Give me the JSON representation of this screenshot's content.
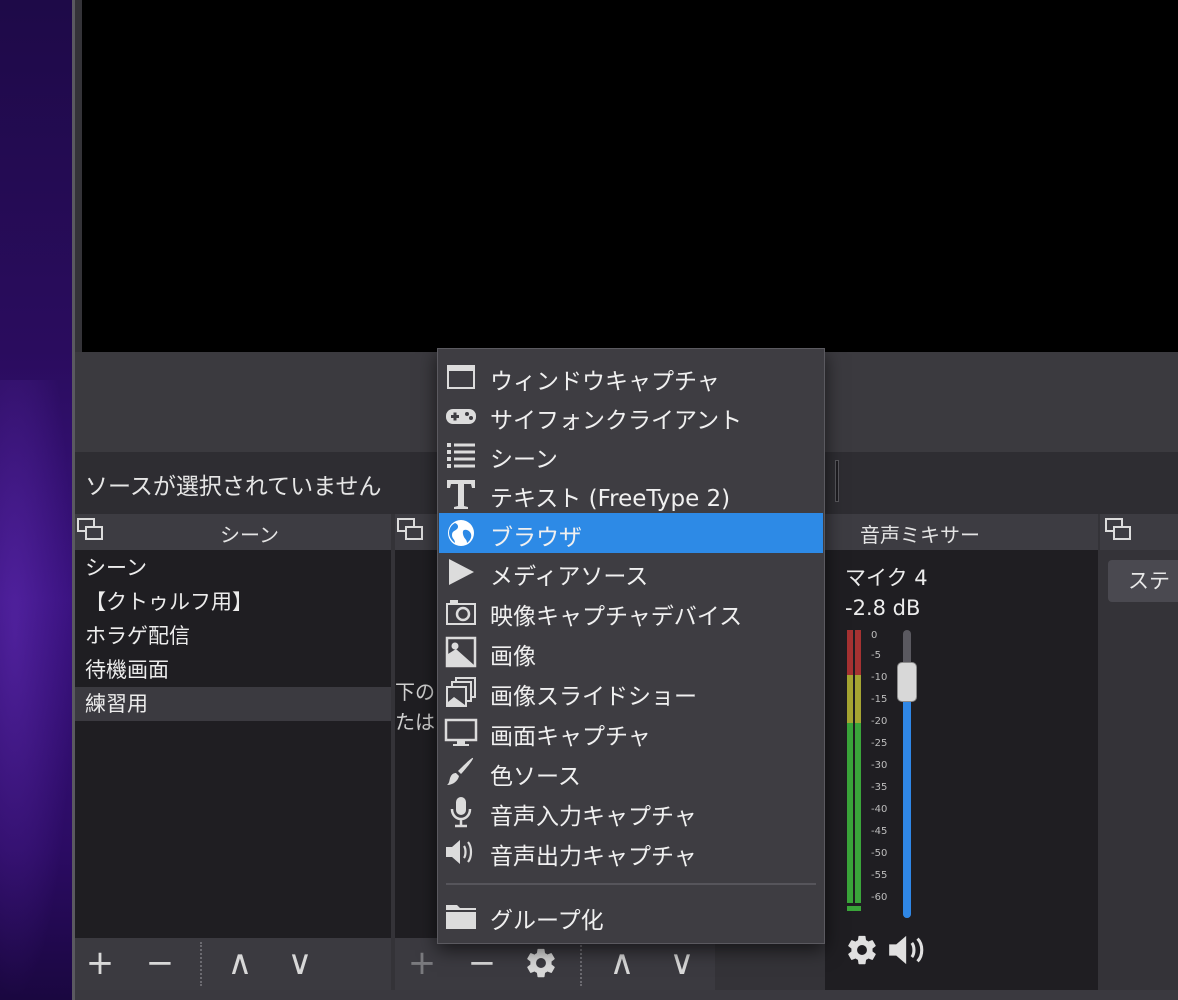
{
  "status": {
    "no_source_text": "ソースが選択されていません"
  },
  "scenes_dock": {
    "title": "シーン",
    "items": [
      {
        "label": "シーン",
        "selected": false
      },
      {
        "label": "【クトゥルフ用】",
        "selected": false
      },
      {
        "label": "ホラゲ配信",
        "selected": false
      },
      {
        "label": "待機画面",
        "selected": false
      },
      {
        "label": "練習用",
        "selected": true
      }
    ],
    "footer": {
      "add": "+",
      "remove": "−",
      "up": "∧",
      "down": "∨"
    }
  },
  "sources_dock": {
    "hint_line1": "下の",
    "hint_line2": "たは",
    "footer": {
      "add": "+",
      "remove": "−",
      "up": "∧",
      "down": "∨"
    }
  },
  "mixer_dock": {
    "title": "音声ミキサー",
    "channel_name": "マイク 4",
    "channel_db": "-2.8 dB",
    "scale": [
      "0",
      "-5",
      "-10",
      "-15",
      "-20",
      "-25",
      "-30",
      "-35",
      "-40",
      "-45",
      "-50",
      "-55",
      "-60"
    ],
    "fader_level_fraction": 0.79,
    "colors": {
      "green": "#3aa53a",
      "yellow": "#a5a532",
      "red": "#a53232",
      "fader": "#2f87e6"
    }
  },
  "right_dock": {
    "button_label": "ステ"
  },
  "context_menu": {
    "items": [
      {
        "label": "ウィンドウキャプチャ",
        "icon": "window-icon"
      },
      {
        "label": "サイフォンクライアント",
        "icon": "gamepad-icon"
      },
      {
        "label": "シーン",
        "icon": "list-icon"
      },
      {
        "label": "テキスト (FreeType 2)",
        "icon": "text-icon"
      },
      {
        "label": "ブラウザ",
        "icon": "globe-icon",
        "highlighted": true
      },
      {
        "label": "メディアソース",
        "icon": "play-icon"
      },
      {
        "label": "映像キャプチャデバイス",
        "icon": "camera-icon"
      },
      {
        "label": "画像",
        "icon": "image-icon"
      },
      {
        "label": "画像スライドショー",
        "icon": "slideshow-icon"
      },
      {
        "label": "画面キャプチャ",
        "icon": "monitor-icon"
      },
      {
        "label": "色ソース",
        "icon": "brush-icon"
      },
      {
        "label": "音声入力キャプチャ",
        "icon": "microphone-icon"
      },
      {
        "label": "音声出力キャプチャ",
        "icon": "speaker-icon"
      }
    ],
    "group_item": {
      "label": "グループ化",
      "icon": "folder-icon"
    },
    "highlight_color": "#2d8ae6"
  }
}
